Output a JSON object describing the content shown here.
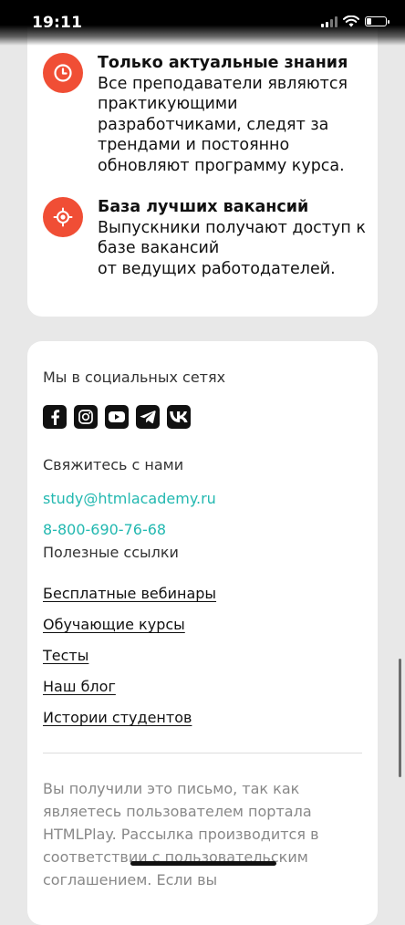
{
  "status_bar": {
    "time": "19:11",
    "icons": [
      "signal-icon",
      "wifi-icon",
      "battery-icon"
    ]
  },
  "features": [
    {
      "icon": "clock-icon",
      "title": "Только актуальные знания",
      "description": "Все преподаватели являются\nпрактикующими\nразработчиками, следят за\nтрендами и постоянно\nобновляют программу курса."
    },
    {
      "icon": "target-icon",
      "title": "База лучших вакансий",
      "description": "Выпускники получают доступ к\nбазе вакансий\nот ведущих работодателей."
    }
  ],
  "footer": {
    "social_label": "Мы в социальных сетях",
    "social_icons": [
      "facebook-icon",
      "instagram-icon",
      "youtube-icon",
      "telegram-icon",
      "vk-icon"
    ],
    "contact_label": "Свяжитесь с нами",
    "email": "study@htmlacademy.ru",
    "phone": "8-800-690-76-68",
    "links_label": "Полезные ссылки",
    "links": [
      "Бесплатные вебинары",
      "Обучающие курсы",
      "Тесты",
      "Наш блог",
      "Истории студентов"
    ],
    "notice": "Вы получили это письмо, так как являетесь пользователем портала HTMLPlay. Рассылка производится в соответствии с пользовательским соглашением. Если вы"
  },
  "colors": {
    "accent": "#f04e35",
    "link": "#22b8b0",
    "background": "#e8e8e8",
    "card": "#ffffff"
  }
}
